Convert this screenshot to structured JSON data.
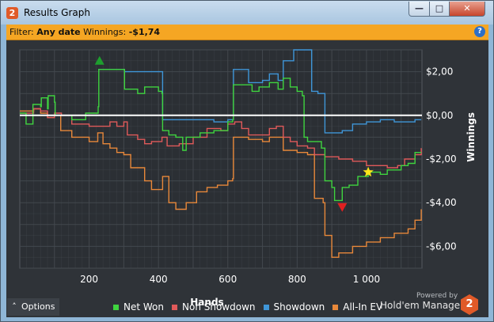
{
  "window": {
    "app_icon_text": "2",
    "title": "Results Graph",
    "minimize_glyph": "—",
    "maximize_glyph": "□",
    "close_glyph": "✕"
  },
  "filter": {
    "prefix": "Filter: ",
    "date_value": "Any date",
    "winnings_label": " Winnings: ",
    "winnings_value": "-$1,74",
    "help_glyph": "?"
  },
  "footer": {
    "options_label": "Options",
    "options_icon": "chevron-up-icon",
    "powered_by": "Powered by",
    "brand": "Hold'em Manager",
    "brand_logo_text": "2"
  },
  "colors": {
    "net_won": "#3fd43f",
    "non_showdown": "#e05a5a",
    "showdown": "#3f96d8",
    "all_in_ev": "#e8883a",
    "filter_bar": "#f5a623",
    "plot_bg": "#2f3338",
    "grid": "#454a50",
    "zero_line": "#ffffff"
  },
  "chart_data": {
    "type": "line",
    "xlabel": "Hands",
    "ylabel": "Winnings",
    "xlim": [
      0,
      1160
    ],
    "ylim": [
      -7,
      3
    ],
    "x_ticks": [
      200,
      400,
      600,
      800,
      1000
    ],
    "x_tick_labels": [
      "200",
      "400",
      "600",
      "800",
      "1 000"
    ],
    "y_ticks": [
      2,
      0,
      -2,
      -4,
      -6
    ],
    "y_tick_labels": [
      "$2,00",
      "$0,00",
      "-$2,00",
      "-$4,00",
      "-$6,00"
    ],
    "grid": true,
    "legend_position": "bottom",
    "series": [
      {
        "name": "Net Won",
        "color_key": "net_won",
        "points": [
          [
            0,
            0.1
          ],
          [
            15,
            0.1
          ],
          [
            18,
            -0.4
          ],
          [
            35,
            -0.4
          ],
          [
            38,
            0.5
          ],
          [
            60,
            0.4
          ],
          [
            62,
            0.8
          ],
          [
            80,
            0.3
          ],
          [
            82,
            0.9
          ],
          [
            100,
            0.6
          ],
          [
            102,
            0.0
          ],
          [
            150,
            -0.2
          ],
          [
            170,
            -0.2
          ],
          [
            190,
            0.1
          ],
          [
            215,
            0.1
          ],
          [
            226,
            0.4
          ],
          [
            228,
            2.1
          ],
          [
            300,
            2.1
          ],
          [
            302,
            1.2
          ],
          [
            340,
            1.0
          ],
          [
            360,
            1.3
          ],
          [
            380,
            1.3
          ],
          [
            400,
            1.1
          ],
          [
            410,
            1.0
          ],
          [
            412,
            -0.7
          ],
          [
            430,
            -0.9
          ],
          [
            450,
            -1.0
          ],
          [
            470,
            -1.6
          ],
          [
            480,
            -1.0
          ],
          [
            520,
            -0.8
          ],
          [
            560,
            -0.7
          ],
          [
            600,
            -0.3
          ],
          [
            614,
            -0.2
          ],
          [
            616,
            1.4
          ],
          [
            650,
            1.4
          ],
          [
            670,
            1.1
          ],
          [
            690,
            1.3
          ],
          [
            720,
            1.5
          ],
          [
            745,
            1.2
          ],
          [
            760,
            1.7
          ],
          [
            780,
            1.3
          ],
          [
            800,
            1.1
          ],
          [
            815,
            0.9
          ],
          [
            820,
            -1.0
          ],
          [
            830,
            -1.2
          ],
          [
            850,
            -1.2
          ],
          [
            870,
            -1.5
          ],
          [
            880,
            -3.0
          ],
          [
            900,
            -3.3
          ],
          [
            908,
            -3.9
          ],
          [
            920,
            -3.9
          ],
          [
            930,
            -3.3
          ],
          [
            950,
            -3.2
          ],
          [
            975,
            -2.8
          ],
          [
            1005,
            -2.6
          ],
          [
            1040,
            -2.7
          ],
          [
            1060,
            -2.5
          ],
          [
            1080,
            -2.5
          ],
          [
            1100,
            -2.3
          ],
          [
            1120,
            -2.2
          ],
          [
            1140,
            -1.7
          ],
          [
            1158,
            -1.7
          ]
        ]
      },
      {
        "name": "Non Showdown",
        "color_key": "non_showdown",
        "points": [
          [
            0,
            0.1
          ],
          [
            40,
            0.3
          ],
          [
            60,
            0.2
          ],
          [
            80,
            -0.1
          ],
          [
            100,
            0.1
          ],
          [
            120,
            0.0
          ],
          [
            150,
            -0.4
          ],
          [
            200,
            -0.5
          ],
          [
            230,
            -0.5
          ],
          [
            260,
            -0.3
          ],
          [
            280,
            -0.5
          ],
          [
            300,
            -0.3
          ],
          [
            310,
            -0.9
          ],
          [
            340,
            -1.1
          ],
          [
            360,
            -1.3
          ],
          [
            380,
            -1.2
          ],
          [
            410,
            -1.0
          ],
          [
            425,
            -1.4
          ],
          [
            440,
            -1.4
          ],
          [
            460,
            -1.3
          ],
          [
            500,
            -1.0
          ],
          [
            520,
            -1.0
          ],
          [
            540,
            -0.6
          ],
          [
            580,
            -0.7
          ],
          [
            600,
            -0.4
          ],
          [
            620,
            -0.3
          ],
          [
            640,
            -0.6
          ],
          [
            660,
            -0.9
          ],
          [
            690,
            -0.9
          ],
          [
            720,
            -0.6
          ],
          [
            740,
            -0.5
          ],
          [
            760,
            -1.0
          ],
          [
            780,
            -1.2
          ],
          [
            800,
            -1.4
          ],
          [
            830,
            -1.5
          ],
          [
            850,
            -1.8
          ],
          [
            880,
            -1.9
          ],
          [
            920,
            -2.0
          ],
          [
            960,
            -2.1
          ],
          [
            1000,
            -2.3
          ],
          [
            1030,
            -2.3
          ],
          [
            1060,
            -2.4
          ],
          [
            1090,
            -2.3
          ],
          [
            1110,
            -2.0
          ],
          [
            1140,
            -1.8
          ],
          [
            1158,
            -1.5
          ]
        ]
      },
      {
        "name": "Showdown",
        "color_key": "showdown",
        "points": [
          [
            226,
            2.1
          ],
          [
            230,
            2.1
          ],
          [
            300,
            2.1
          ],
          [
            302,
            2.0
          ],
          [
            400,
            2.0
          ],
          [
            412,
            -0.2
          ],
          [
            560,
            -0.3
          ],
          [
            600,
            -0.2
          ],
          [
            616,
            2.1
          ],
          [
            650,
            2.1
          ],
          [
            660,
            1.5
          ],
          [
            700,
            1.6
          ],
          [
            720,
            1.9
          ],
          [
            745,
            1.6
          ],
          [
            760,
            2.5
          ],
          [
            780,
            2.5
          ],
          [
            790,
            3.0
          ],
          [
            840,
            3.0
          ],
          [
            842,
            1.1
          ],
          [
            860,
            1.0
          ],
          [
            880,
            -0.8
          ],
          [
            900,
            -0.8
          ],
          [
            930,
            -0.7
          ],
          [
            960,
            -0.4
          ],
          [
            1000,
            -0.3
          ],
          [
            1040,
            -0.2
          ],
          [
            1080,
            -0.3
          ],
          [
            1120,
            -0.3
          ],
          [
            1140,
            -0.2
          ],
          [
            1158,
            -0.2
          ]
        ]
      },
      {
        "name": "All-In EV",
        "color_key": "all_in_ev",
        "points": [
          [
            0,
            0.2
          ],
          [
            40,
            0.3
          ],
          [
            60,
            0.1
          ],
          [
            80,
            -0.1
          ],
          [
            100,
            0.0
          ],
          [
            118,
            -0.7
          ],
          [
            150,
            -1.0
          ],
          [
            200,
            -1.2
          ],
          [
            225,
            -0.8
          ],
          [
            240,
            -1.3
          ],
          [
            260,
            -1.5
          ],
          [
            280,
            -1.7
          ],
          [
            300,
            -1.8
          ],
          [
            320,
            -2.4
          ],
          [
            360,
            -3.0
          ],
          [
            380,
            -3.4
          ],
          [
            412,
            -2.8
          ],
          [
            430,
            -4.0
          ],
          [
            450,
            -4.3
          ],
          [
            480,
            -4.0
          ],
          [
            510,
            -3.5
          ],
          [
            540,
            -3.3
          ],
          [
            570,
            -3.2
          ],
          [
            600,
            -3.0
          ],
          [
            614,
            -2.9
          ],
          [
            616,
            -1.0
          ],
          [
            660,
            -1.1
          ],
          [
            700,
            -1.2
          ],
          [
            720,
            -1.0
          ],
          [
            745,
            -1.0
          ],
          [
            760,
            -1.6
          ],
          [
            780,
            -1.6
          ],
          [
            800,
            -1.7
          ],
          [
            830,
            -1.8
          ],
          [
            850,
            -3.8
          ],
          [
            875,
            -4.0
          ],
          [
            880,
            -5.5
          ],
          [
            900,
            -6.5
          ],
          [
            920,
            -6.3
          ],
          [
            960,
            -6.0
          ],
          [
            1000,
            -5.8
          ],
          [
            1040,
            -5.6
          ],
          [
            1080,
            -5.4
          ],
          [
            1120,
            -5.2
          ],
          [
            1140,
            -4.8
          ],
          [
            1158,
            -4.3
          ]
        ]
      }
    ],
    "markers": [
      {
        "kind": "triangle-up",
        "color": "#1e9e2e",
        "x": 230,
        "y": 2.5
      },
      {
        "kind": "triangle-down",
        "color": "#e02020",
        "x": 930,
        "y": -4.2
      },
      {
        "kind": "star",
        "color": "#ffe619",
        "x": 1005,
        "y": -2.6
      }
    ]
  }
}
